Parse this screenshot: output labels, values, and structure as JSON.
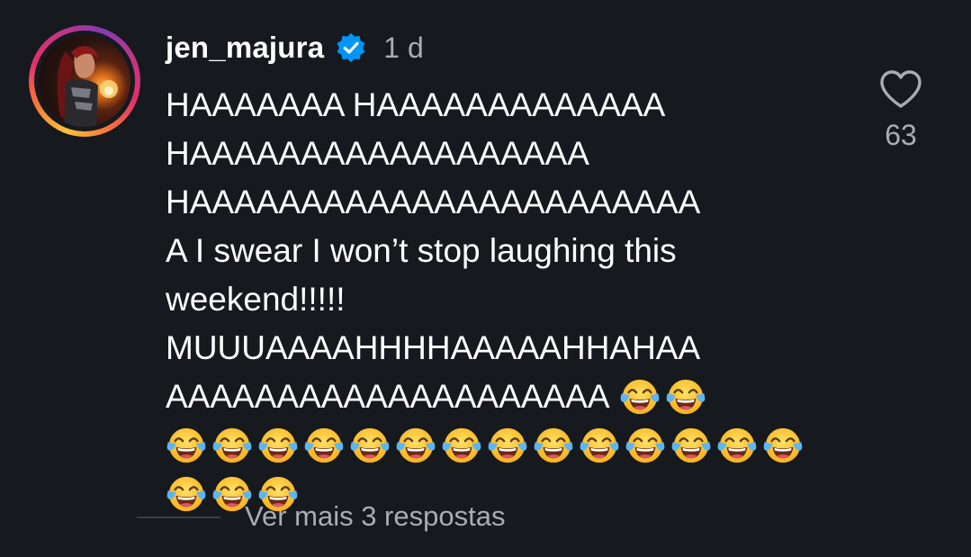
{
  "comment": {
    "username": "jen_majura",
    "verified_icon": "verified-badge-icon",
    "time": "1 d",
    "lines": [
      "HAAAAAAA HAAAAAAAAAAAAA",
      "HAAAAAAAAAAAAAAAAAA",
      "HAAAAAAAAAAAAAAAAAAAAAAA",
      "A I swear I won’t stop laughing this",
      "weekend!!!!!",
      "MUUUAAAAHHHHAAAAAHHAHAA",
      "AAAAAAAAAAAAAAAAAAAA"
    ],
    "emoji": "face-with-tears-of-joy",
    "emoji_rows": [
      2,
      14,
      3
    ],
    "like_icon": "heart-outline-icon",
    "like_count": "63",
    "replies_label": "Ver mais 3 respostas"
  },
  "colors": {
    "background": "#16191e",
    "text": "#ffffff",
    "muted": "#a8adb5",
    "verified": "#0095f6"
  }
}
